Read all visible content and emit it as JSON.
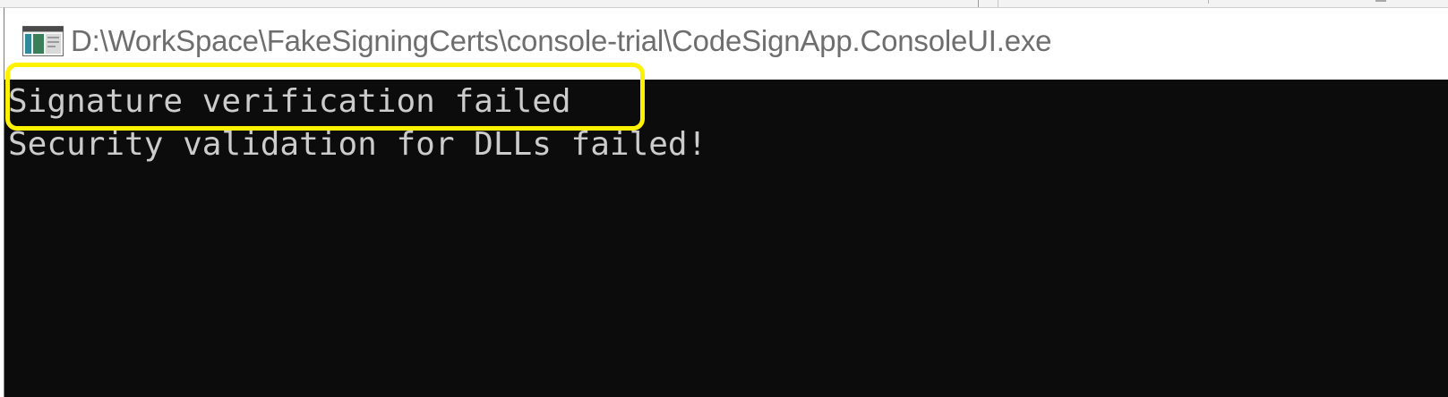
{
  "window": {
    "title": "D:\\WorkSpace\\FakeSigningCerts\\console-trial\\CodeSignApp.ConsoleUI.exe",
    "icon": "console-app-icon"
  },
  "console": {
    "lines": [
      "Signature verification failed",
      "Security validation for DLLs failed!"
    ],
    "background_color": "#0c0c0c",
    "text_color": "#cccccc"
  },
  "annotation": {
    "type": "highlight-box",
    "color": "#fff200"
  }
}
